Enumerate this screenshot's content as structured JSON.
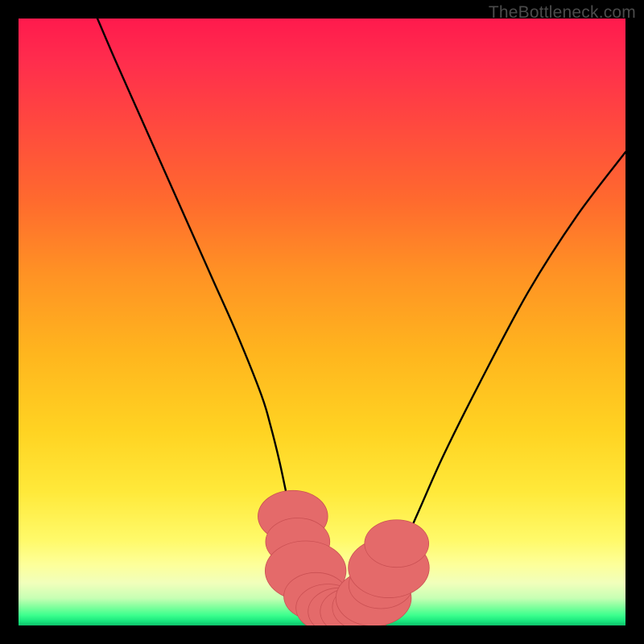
{
  "watermark": "TheBottleneck.com",
  "chart_data": {
    "type": "line",
    "title": "",
    "xlabel": "",
    "ylabel": "",
    "xlim": [
      0,
      100
    ],
    "ylim": [
      0,
      100
    ],
    "curve": {
      "x": [
        13,
        16,
        20,
        24,
        28,
        32,
        36,
        40,
        41.5,
        43,
        44.5,
        46,
        48,
        50,
        52,
        54,
        56,
        58,
        60,
        62,
        66,
        70,
        76,
        84,
        92,
        100
      ],
      "y": [
        100,
        93,
        84,
        75,
        66,
        57,
        48,
        38,
        33,
        27,
        20,
        13.5,
        7.5,
        4,
        2.4,
        2.2,
        2.4,
        3.5,
        6,
        10,
        19,
        28,
        40,
        55,
        67.5,
        78
      ]
    },
    "markers": {
      "x": [
        45.2,
        46.0,
        47.3,
        49.0,
        51.0,
        53.0,
        55.0,
        57.0,
        58.5,
        59.7,
        61.0,
        62.3
      ],
      "y": [
        18.0,
        13.8,
        9.0,
        4.8,
        2.9,
        2.3,
        2.3,
        3.0,
        4.5,
        6.7,
        9.5,
        13.5
      ],
      "r": [
        5.0,
        4.6,
        5.8,
        4.6,
        4.6,
        4.6,
        4.6,
        4.6,
        5.4,
        4.6,
        5.8,
        4.6
      ]
    },
    "note": "x/y are percentages of the plot area (origin bottom-left). Curve is a smooth V-shape with floor near x≈54%. Markers are salmon ellipses clustered around the trough."
  }
}
